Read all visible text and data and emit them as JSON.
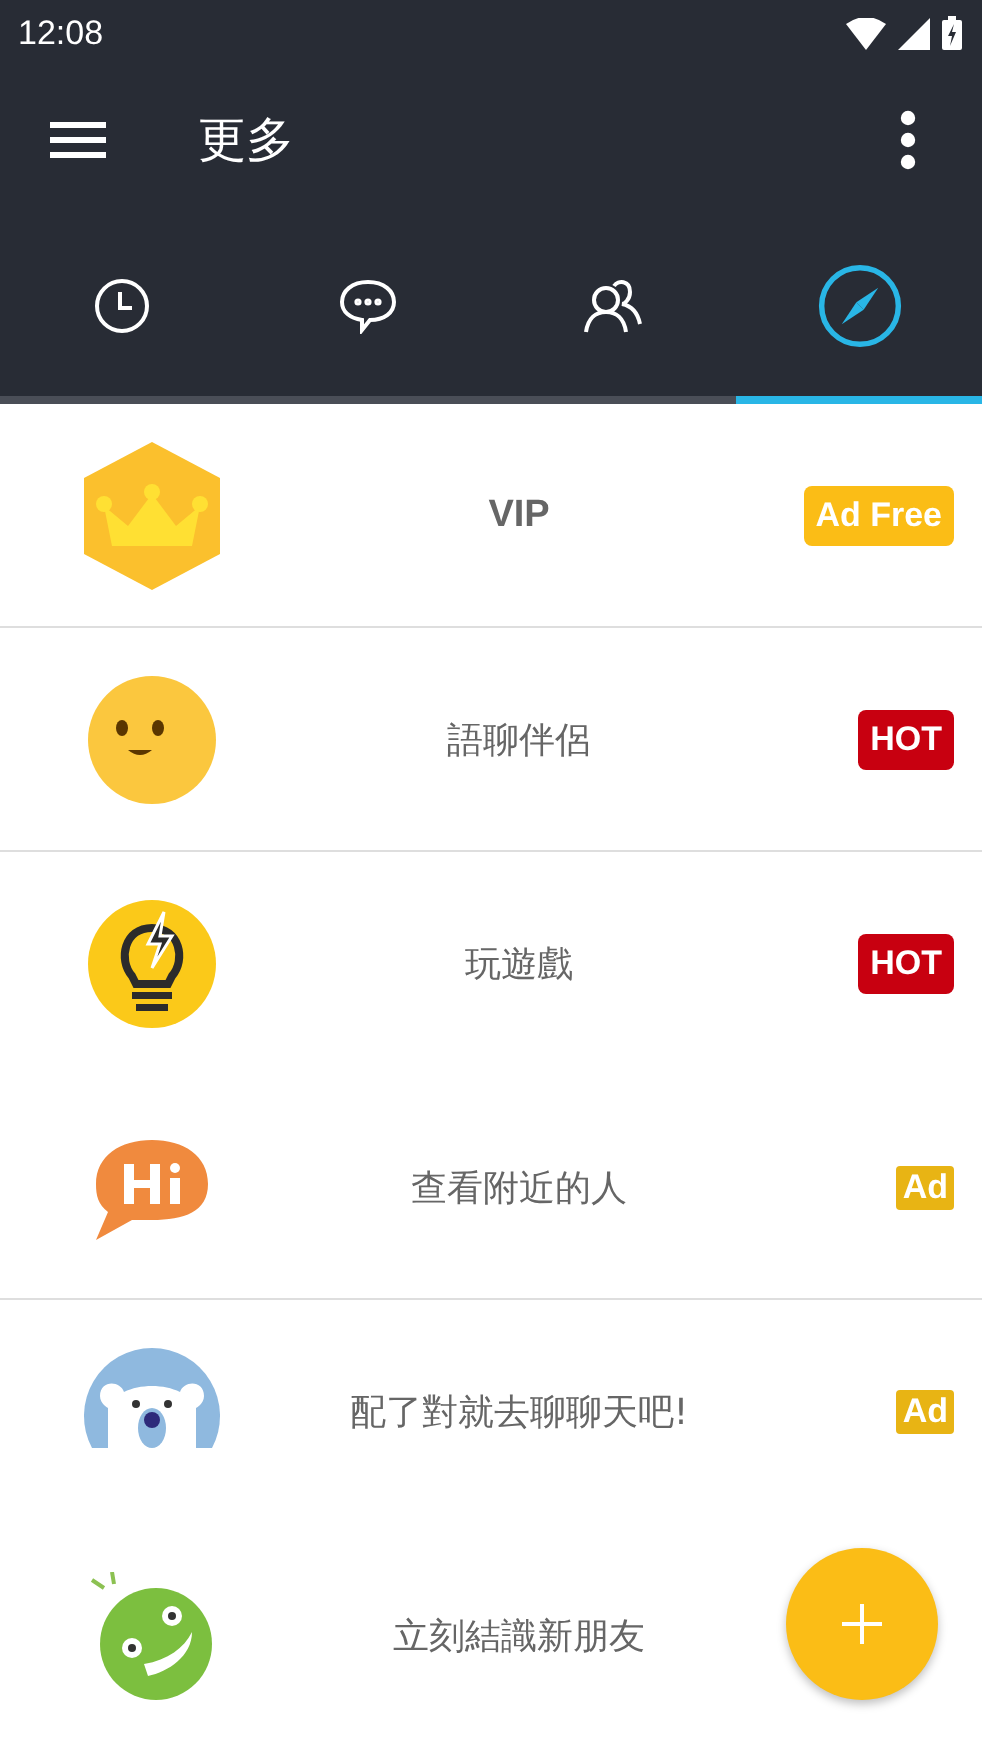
{
  "status_bar": {
    "time": "12:08"
  },
  "toolbar": {
    "title": "更多"
  },
  "tabs": [
    {
      "kind": "clock",
      "selected": false
    },
    {
      "kind": "chat",
      "selected": false
    },
    {
      "kind": "people",
      "selected": false
    },
    {
      "kind": "compass",
      "selected": true
    }
  ],
  "rows": [
    {
      "kind": "crown",
      "label": "VIP",
      "badge": {
        "kind": "ad_free",
        "text": "Ad Free"
      },
      "divider": true
    },
    {
      "kind": "smiley",
      "label": "語聊伴侶",
      "badge": {
        "kind": "hot",
        "text": "HOT"
      },
      "divider": true
    },
    {
      "kind": "bulb",
      "label": "玩遊戲",
      "badge": {
        "kind": "hot",
        "text": "HOT"
      },
      "divider": false
    },
    {
      "kind": "hi",
      "label": "查看附近的人",
      "badge": {
        "kind": "ad",
        "text": "Ad"
      },
      "divider": true
    },
    {
      "kind": "bear",
      "label": "配了對就去聊聊天吧!",
      "badge": {
        "kind": "ad",
        "text": "Ad"
      },
      "divider": false
    },
    {
      "kind": "grin",
      "label": "立刻結識新朋友"
    }
  ]
}
